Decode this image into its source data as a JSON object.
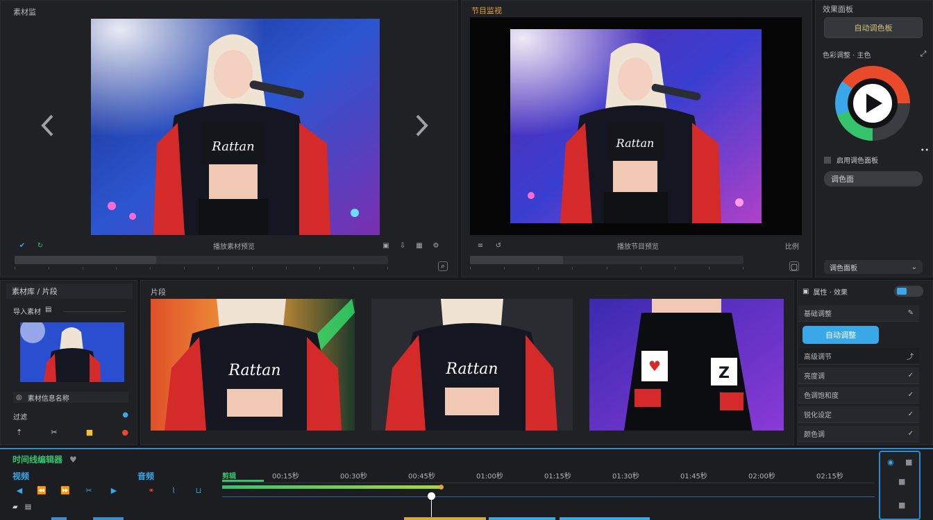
{
  "source_monitor": {
    "title": "素材监",
    "center_label": "播放素材预览"
  },
  "program_monitor": {
    "title": "节目监视",
    "center_label": "播放节目预览",
    "right_label": "比例"
  },
  "inspector": {
    "title": "效果面板",
    "top_button": "自动调色板",
    "color_section": "色彩调整 · 主色",
    "checkbox_label": "启用调色面板",
    "pill": "调色面",
    "footer_select": "调色面板"
  },
  "media_bin": {
    "title": "素材库 / 片段",
    "sub": "导入素材",
    "row1": "素材信息名称",
    "row2": "过滤"
  },
  "thumbnails": {
    "title": "片段"
  },
  "properties": {
    "title": "属性 · 效果",
    "row1": "基础调整",
    "button": "自动调整",
    "row2": "高级调节",
    "row3": "亮度调",
    "row4": "色调饱和度",
    "row5": "锐化设定",
    "row6": "颜色调"
  },
  "timeline": {
    "title": "时间线编辑器",
    "track1": "视频",
    "track2": "音频",
    "ruler": [
      "剪辑",
      "00:15秒",
      "00:30秒",
      "00:45秒",
      "01:00秒",
      "01:15秒",
      "01:30秒",
      "01:45秒",
      "02:00秒",
      "02:15秒"
    ]
  },
  "colors": {
    "accent_blue": "#3aa8e8",
    "accent_green": "#35c46b",
    "accent_orange": "#e8a23a",
    "play_ring": [
      "#e84a2a",
      "#f2c23a",
      "#35c46b",
      "#3aa8e8",
      "#8a5ad8"
    ]
  }
}
